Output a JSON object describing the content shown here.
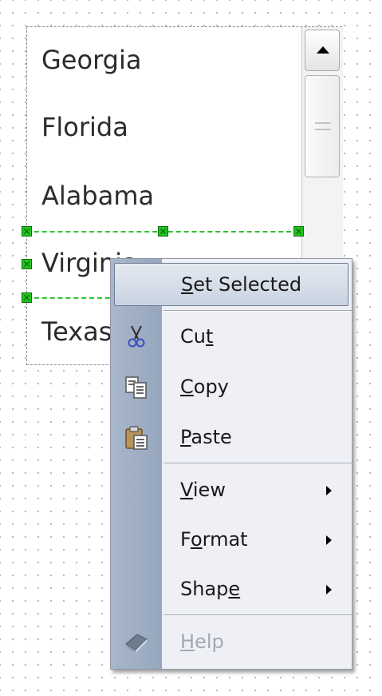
{
  "listbox": {
    "items": [
      "Georgia",
      "Florida",
      "Alabama",
      "Virginia",
      "Texas"
    ]
  },
  "context_menu": {
    "items": [
      {
        "label_pre": "",
        "label_ul": "S",
        "label_post": "et Selected",
        "icon": "",
        "submenu": false,
        "enabled": true,
        "highlighted": true
      },
      {
        "label_pre": "Cu",
        "label_ul": "t",
        "label_post": "",
        "icon": "scissors-icon",
        "submenu": false,
        "enabled": true,
        "highlighted": false
      },
      {
        "label_pre": "",
        "label_ul": "C",
        "label_post": "opy",
        "icon": "copy-icon",
        "submenu": false,
        "enabled": true,
        "highlighted": false
      },
      {
        "label_pre": "",
        "label_ul": "P",
        "label_post": "aste",
        "icon": "paste-icon",
        "submenu": false,
        "enabled": true,
        "highlighted": false
      },
      {
        "label_pre": "",
        "label_ul": "V",
        "label_post": "iew",
        "icon": "",
        "submenu": true,
        "enabled": true,
        "highlighted": false
      },
      {
        "label_pre": "F",
        "label_ul": "o",
        "label_post": "rmat",
        "icon": "",
        "submenu": true,
        "enabled": true,
        "highlighted": false
      },
      {
        "label_pre": "Shap",
        "label_ul": "e",
        "label_post": "",
        "icon": "",
        "submenu": true,
        "enabled": true,
        "highlighted": false
      },
      {
        "label_pre": "",
        "label_ul": "H",
        "label_post": "elp",
        "icon": "help-book-icon",
        "submenu": false,
        "enabled": false,
        "highlighted": false
      }
    ]
  },
  "colors": {
    "selection": "#2fc22f",
    "menu_gutter": "#a3b3c8",
    "menu_bg": "#eef0f5"
  }
}
